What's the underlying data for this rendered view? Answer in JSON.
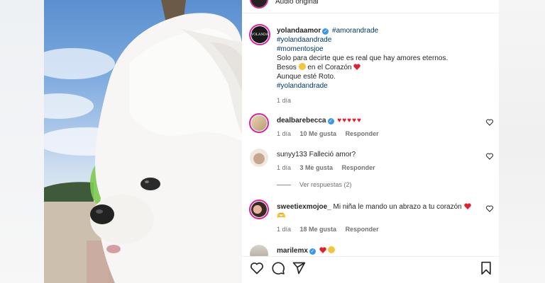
{
  "audio": {
    "label": "Audio original"
  },
  "post": {
    "username": "yolandaamor",
    "tags_line1": "#amorandrade",
    "tags_line2": "#yolandaandrade",
    "tags_line3": "#momentosjoe",
    "caption1": "Solo para decirte que es real que hay amores eternos.",
    "caption2a": "Besos",
    "caption2b": "en el Corazón",
    "caption3": "Aunque esté Roto.",
    "caption_tag": "#yolandandrade",
    "time": "1 día",
    "avatar_text": "YOLANDA"
  },
  "comments": [
    {
      "username": "dealbarebecca",
      "text": "",
      "time": "1 día",
      "likes": "10 Me gusta",
      "reply": "Responder"
    },
    {
      "username": "sunyy133",
      "text": "Falleció amor?",
      "time": "1 día",
      "likes": "3 Me gusta",
      "reply": "Responder"
    },
    {
      "view_replies": "Ver respuestas (2)"
    },
    {
      "username": "sweetiexmojoe_",
      "text": "Mi niña le mando un abrazo a tu corazón",
      "text2": "🫶",
      "time": "1 día",
      "likes": "18 Me gusta",
      "reply": "Responder"
    },
    {
      "username": "marilemx",
      "text": ""
    }
  ],
  "colors": {
    "heart": "#e0202e",
    "verified": "#3897f0",
    "tag": "#00376b",
    "meta": "#737373"
  }
}
